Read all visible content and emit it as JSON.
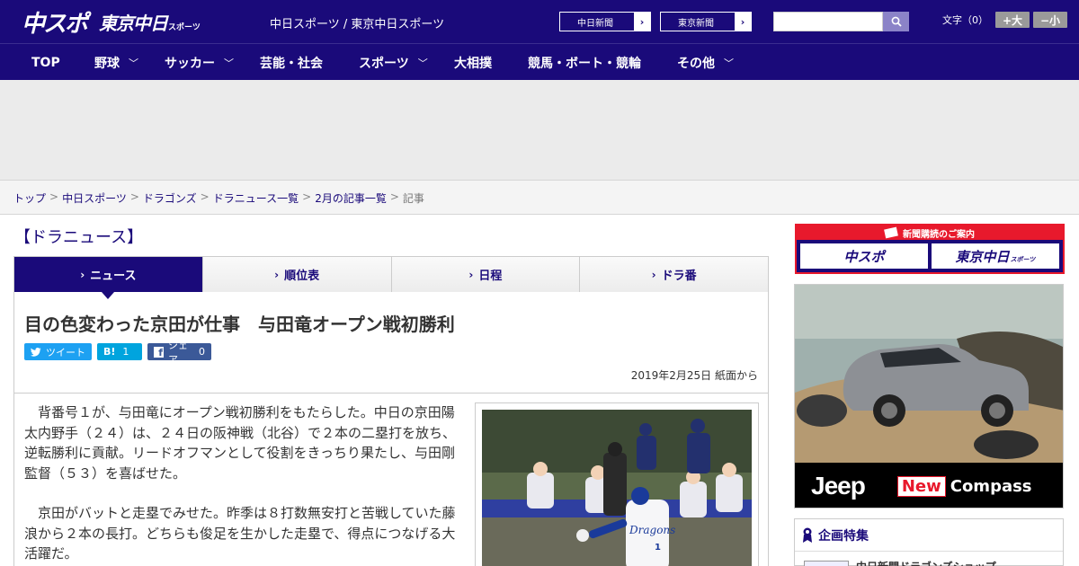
{
  "header": {
    "logo_chuspo": "中スポ",
    "logo_tokyo": "東京中日",
    "logo_tokyo_small": "スポーツ",
    "site_name": "中日スポーツ / 東京中日スポーツ",
    "ext_links": [
      "中日新聞",
      "東京新聞"
    ],
    "search_placeholder": "",
    "font_label": "文字（0）",
    "font_bigger": "+大",
    "font_smaller": "−小"
  },
  "nav": {
    "items": [
      {
        "label": "TOP",
        "has_menu": false
      },
      {
        "label": "野球",
        "has_menu": true
      },
      {
        "label": "サッカー",
        "has_menu": true
      },
      {
        "label": "芸能・社会",
        "has_menu": false
      },
      {
        "label": "スポーツ",
        "has_menu": true
      },
      {
        "label": "大相撲",
        "has_menu": false
      },
      {
        "label": "競馬・ボート・競輪",
        "has_menu": false
      },
      {
        "label": "その他",
        "has_menu": true
      }
    ]
  },
  "breadcrumb": [
    "トップ",
    "中日スポーツ",
    "ドラゴンズ",
    "ドラニュース一覧",
    "2月の記事一覧",
    "記事"
  ],
  "section_title": "【ドラニュース】",
  "tabs": [
    {
      "label": "ニュース",
      "active": true
    },
    {
      "label": "順位表",
      "active": false
    },
    {
      "label": "日程",
      "active": false
    },
    {
      "label": "ドラ番",
      "active": false
    }
  ],
  "article": {
    "headline": "目の色変わった京田が仕事　与田竜オープン戦初勝利",
    "share": {
      "tweet": "ツイート",
      "hatebu_label": "B!",
      "hatebu_count": "1",
      "facebook": "シェア",
      "facebook_count": "0"
    },
    "dateline": "2019年2月25日 紙面から",
    "paragraphs": [
      "背番号１が、与田竜にオープン戦初勝利をもたらした。中日の京田陽太内野手（２４）は、２４日の阪神戦（北谷）で２本の二塁打を放ち、逆転勝利に貢献。リードオフマンとして役割をきっちり果たし、与田剛監督（５３）を喜ばせた。",
      "京田がバットと走塁でみせた。昨季は８打数無安打と苦戦していた藤浪から２本の長打。どちらも俊足を生かした走塁で、得点につなげる大活躍だ。"
    ],
    "photo": {
      "jersey_text": "Dragons",
      "jersey_number": "1"
    }
  },
  "sidebar": {
    "subscribe_title": "新聞購読のご案内",
    "subscribe_logos": [
      "中スポ",
      "東京中日"
    ],
    "subscribe_logo_small": "スポーツ",
    "ad": {
      "brand": "Jeep",
      "new_label": "New",
      "model": "Compass"
    },
    "feature_title": "企画特集",
    "feature_item": "中日新聞ドラゴンズショップ"
  },
  "colors": {
    "brand_navy": "#1a0a7a",
    "accent_red": "#e8192c",
    "twitter": "#1da1f2",
    "hatena": "#00a4de",
    "facebook": "#3b5998"
  }
}
